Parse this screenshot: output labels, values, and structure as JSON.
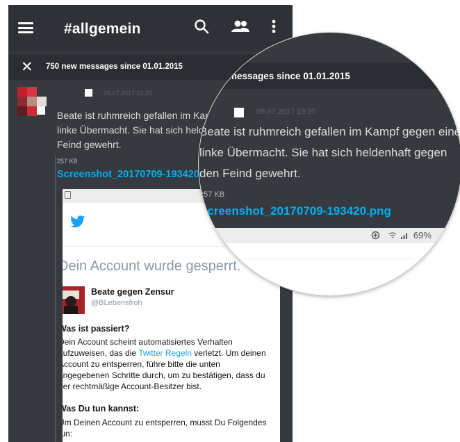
{
  "header": {
    "channel": "#allgemein",
    "icons": [
      "menu-icon",
      "search-icon",
      "members-icon",
      "more-vert-icon"
    ]
  },
  "new_messages": {
    "close_glyph": "✕",
    "text": "750 new messages since 01.01.2015"
  },
  "message": {
    "timestamp": "09.07.2017 19:35",
    "text": "Beate ist ruhmreich gefallen im Kampf gegen eine linke Übermacht. Sie hat sich heldenhaft gegen den Feind gewehrt.",
    "attachment_size": "257 KB",
    "attachment_name": "Screenshot_20170709-193420.png"
  },
  "embedded_screenshot": {
    "heading": "Dein Account wurde gesperrt.",
    "profile_name": "Beate gegen Zensur",
    "profile_handle": "@BLebensfroh",
    "section1_title": "Was ist passiert?",
    "section1_before_link": "Dein Account scheint automatisiertes Verhalten aufzuweisen, das die ",
    "section1_link": "Twitter Regeln",
    "section1_after_link": " verletzt. Um deinen Account zu entsperren, führe bitte die unten angegebenen Schritte durch, um zu bestätigen, dass du der rechtmäßige Account-Besitzer bist.",
    "section2_title": "Was Du tun kannst:",
    "section2_text": "Um Deinen Account zu entsperren, musst Du Folgendes tun:"
  },
  "magnifier": {
    "banner": "messages since 01.01.2015",
    "status_bar": "69%"
  },
  "colors": {
    "background": "#36393e",
    "topbar": "#2e3136",
    "banner": "#2a2d32",
    "link": "#00aff4",
    "twitter_blue": "#1da1f2"
  }
}
